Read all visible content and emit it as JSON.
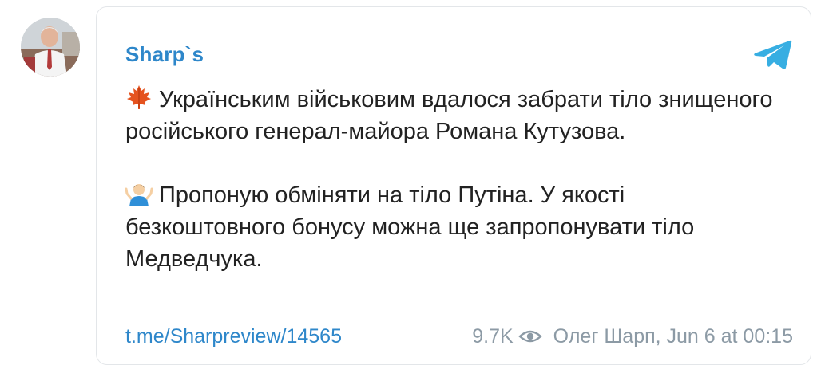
{
  "post": {
    "channel_name": "Sharp`s",
    "paragraphs": [
      {
        "emoji": "maple-leaf-icon",
        "text": "Українським військовим вдалося забрати тіло знищеного російського генерал-майора Романа Кутузова."
      },
      {
        "emoji": "shrugging-person-icon",
        "text": "Пропоную обміняти на тіло Путіна. У якості безкоштовного бонусу можна ще запропонувати тіло Медведчука."
      }
    ],
    "link_text": "t.me/Sharpreview/14565",
    "views": "9.7K",
    "author_date": "Олег Шарп, Jun 6 at 00:15"
  },
  "colors": {
    "accent": "#2e87ca",
    "text": "#222222",
    "muted": "#8c9aa5",
    "border": "#e3e6e9",
    "telegram_blue": "#37aee2"
  },
  "icons": {
    "avatar": "channel-avatar",
    "logo": "telegram-logo-icon",
    "views": "eye-icon"
  }
}
